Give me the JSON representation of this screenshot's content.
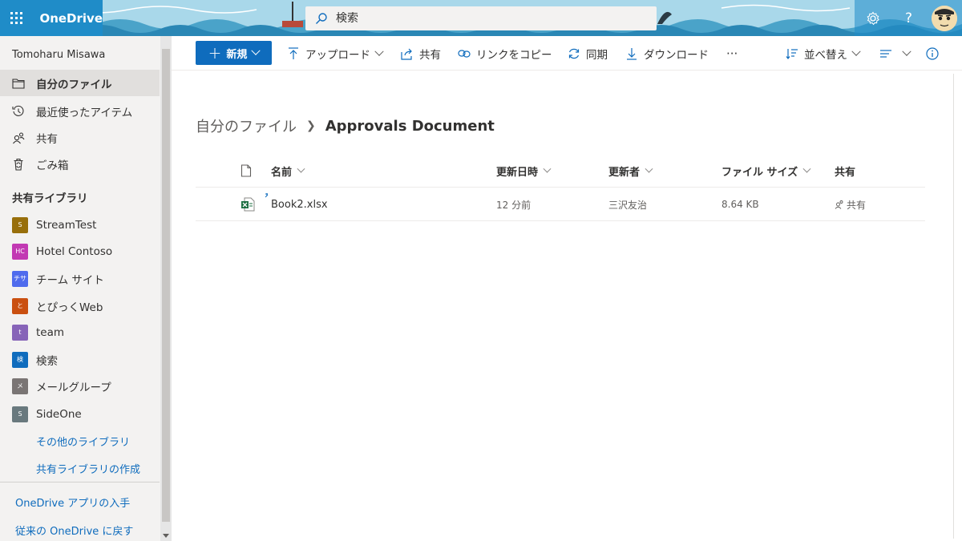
{
  "suite": {
    "app_name": "OneDrive",
    "search_placeholder": "検索"
  },
  "nav": {
    "user_name": "Tomoharu Misawa",
    "items": [
      {
        "label": "自分のファイル"
      },
      {
        "label": "最近使ったアイテム"
      },
      {
        "label": "共有"
      },
      {
        "label": "ごみ箱"
      }
    ],
    "section_title": "共有ライブラリ",
    "libraries": [
      {
        "badge": "S",
        "label": "StreamTest",
        "color": "#986f0b"
      },
      {
        "badge": "HC",
        "label": "Hotel Contoso",
        "color": "#c239b3"
      },
      {
        "badge": "チサ",
        "label": "チーム サイト",
        "color": "#4f6bed"
      },
      {
        "badge": "と",
        "label": "とぴっくWeb",
        "color": "#ca5010"
      },
      {
        "badge": "t",
        "label": "team",
        "color": "#8764b8"
      },
      {
        "badge": "検",
        "label": "検索",
        "color": "#0f6cbd"
      },
      {
        "badge": "メ",
        "label": "メールグループ",
        "color": "#7a7574"
      },
      {
        "badge": "S",
        "label": "SideOne",
        "color": "#69797e"
      }
    ],
    "more_libraries": "その他のライブラリ",
    "create_library": "共有ライブラリの作成",
    "get_app": "OneDrive アプリの入手",
    "classic": "従来の OneDrive に戻す"
  },
  "commands": {
    "new": "新規",
    "upload": "アップロード",
    "share": "共有",
    "copy_link": "リンクをコピー",
    "sync": "同期",
    "download": "ダウンロード",
    "more": "···",
    "sort": "並べ替え"
  },
  "breadcrumb": {
    "root": "自分のファイル",
    "current": "Approvals Document"
  },
  "list": {
    "columns": {
      "name": "名前",
      "modified": "更新日時",
      "modified_by": "更新者",
      "size": "ファイル サイズ",
      "sharing": "共有"
    },
    "rows": [
      {
        "name": "Book2.xlsx",
        "modified": "12 分前",
        "modified_by": "三沢友治",
        "size": "8.64 KB",
        "sharing": "共有"
      }
    ]
  }
}
